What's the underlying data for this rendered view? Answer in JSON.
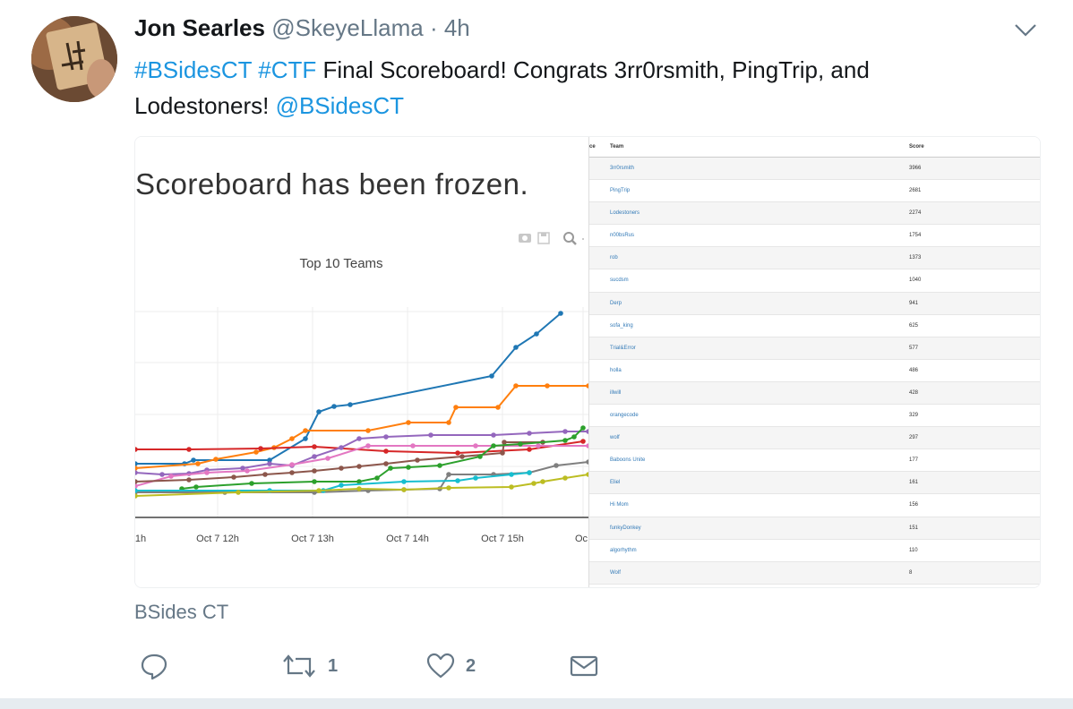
{
  "tweet": {
    "author_name": "Jon Searles",
    "handle": "@SkeyeLlama",
    "separator": "·",
    "time": "4h",
    "text_parts": {
      "hashtag1": "#BSidesCT",
      "hashtag2": "#CTF",
      "body": " Final Scoreboard! Congrats 3rr0rsmith, PingTrip, and Lodestoners! ",
      "mention": "@BSidesCT"
    },
    "card_source": "BSides CT",
    "reply_count": "",
    "retweet_count": "1",
    "like_count": "2"
  },
  "media": {
    "banner": "Scoreboard has been frozen.",
    "chart_data": {
      "type": "line",
      "title": "Top 10 Teams",
      "x_ticks": [
        "1h",
        "Oct 7 12h",
        "Oct 7 13h",
        "Oct 7 14h",
        "Oct 7 15h",
        "Oc"
      ],
      "series": [
        {
          "color": "#1f77b4",
          "points": [
            [
              0,
              60
            ],
            [
              55,
              60
            ],
            [
              65,
              64
            ],
            [
              150,
              64
            ],
            [
              190,
              88
            ],
            [
              205,
              118
            ],
            [
              222,
              124
            ],
            [
              240,
              126
            ],
            [
              398,
              158
            ],
            [
              425,
              190
            ],
            [
              448,
              205
            ],
            [
              475,
              228
            ]
          ]
        },
        {
          "color": "#ff7f0e",
          "points": [
            [
              0,
              55
            ],
            [
              70,
              60
            ],
            [
              90,
              65
            ],
            [
              135,
              73
            ],
            [
              155,
              78
            ],
            [
              175,
              88
            ],
            [
              190,
              97
            ],
            [
              260,
              97
            ],
            [
              305,
              106
            ],
            [
              350,
              106
            ],
            [
              358,
              123
            ],
            [
              405,
              123
            ],
            [
              425,
              147
            ],
            [
              460,
              147
            ],
            [
              506,
              147
            ]
          ]
        },
        {
          "color": "#d62728",
          "points": [
            [
              0,
              76
            ],
            [
              60,
              76
            ],
            [
              140,
              77
            ],
            [
              200,
              79
            ],
            [
              280,
              74
            ],
            [
              360,
              72
            ],
            [
              440,
              76
            ],
            [
              500,
              85
            ]
          ]
        },
        {
          "color": "#9467bd",
          "points": [
            [
              0,
              50
            ],
            [
              30,
              48
            ],
            [
              60,
              49
            ],
            [
              80,
              53
            ],
            [
              120,
              55
            ],
            [
              150,
              60
            ],
            [
              175,
              58
            ],
            [
              200,
              68
            ],
            [
              230,
              78
            ],
            [
              250,
              88
            ],
            [
              280,
              90
            ],
            [
              330,
              92
            ],
            [
              400,
              92
            ],
            [
              440,
              94
            ],
            [
              480,
              96
            ],
            [
              506,
              96
            ]
          ]
        },
        {
          "color": "#e377c2",
          "points": [
            [
              0,
              35
            ],
            [
              40,
              46
            ],
            [
              80,
              50
            ],
            [
              125,
              52
            ],
            [
              175,
              59
            ],
            [
              215,
              66
            ],
            [
              260,
              80
            ],
            [
              310,
              80
            ],
            [
              380,
              80
            ],
            [
              450,
              80
            ],
            [
              506,
              80
            ]
          ]
        },
        {
          "color": "#8c564b",
          "points": [
            [
              0,
              40
            ],
            [
              60,
              42
            ],
            [
              110,
              45
            ],
            [
              145,
              48
            ],
            [
              175,
              50
            ],
            [
              200,
              52
            ],
            [
              230,
              55
            ],
            [
              250,
              57
            ],
            [
              280,
              60
            ],
            [
              315,
              64
            ],
            [
              365,
              68
            ],
            [
              410,
              72
            ],
            [
              412,
              84
            ],
            [
              455,
              84
            ]
          ]
        },
        {
          "color": "#2ca02c",
          "points": [
            [
              52,
              32
            ],
            [
              68,
              34
            ],
            [
              130,
              38
            ],
            [
              200,
              40
            ],
            [
              250,
              40
            ],
            [
              270,
              44
            ],
            [
              285,
              55
            ],
            [
              305,
              56
            ],
            [
              340,
              58
            ],
            [
              385,
              68
            ],
            [
              400,
              80
            ],
            [
              430,
              82
            ],
            [
              480,
              86
            ],
            [
              490,
              90
            ],
            [
              500,
              100
            ]
          ]
        },
        {
          "color": "#7f7f7f",
          "points": [
            [
              0,
              28
            ],
            [
              100,
              28
            ],
            [
              200,
              28
            ],
            [
              260,
              30
            ],
            [
              300,
              31
            ],
            [
              340,
              32
            ],
            [
              350,
              48
            ],
            [
              400,
              48
            ],
            [
              440,
              50
            ],
            [
              470,
              58
            ],
            [
              506,
              62
            ]
          ]
        },
        {
          "color": "#17becf",
          "points": [
            [
              0,
              30
            ],
            [
              150,
              30
            ],
            [
              210,
              30
            ],
            [
              230,
              36
            ],
            [
              300,
              40
            ],
            [
              360,
              41
            ],
            [
              380,
              44
            ],
            [
              420,
              48
            ],
            [
              440,
              50
            ]
          ]
        },
        {
          "color": "#bcbd22",
          "points": [
            [
              0,
              24
            ],
            [
              115,
              28
            ],
            [
              205,
              30
            ],
            [
              250,
              32
            ],
            [
              300,
              31
            ],
            [
              350,
              33
            ],
            [
              420,
              34
            ],
            [
              445,
              38
            ],
            [
              455,
              40
            ],
            [
              480,
              44
            ],
            [
              506,
              48
            ]
          ]
        }
      ]
    },
    "table": {
      "headers": {
        "rank": "ce",
        "team": "Team",
        "score": "Score"
      },
      "rows": [
        {
          "team": "3rr0rsmith",
          "score": "3966"
        },
        {
          "team": "PingTrip",
          "score": "2681"
        },
        {
          "team": "Lodestoners",
          "score": "2274"
        },
        {
          "team": "n00bsRus",
          "score": "1754"
        },
        {
          "team": "rob",
          "score": "1373"
        },
        {
          "team": "sucdsm",
          "score": "1040"
        },
        {
          "team": "Derp",
          "score": "941"
        },
        {
          "team": "sofa_king",
          "score": "625"
        },
        {
          "team": "Trial&Error",
          "score": "577"
        },
        {
          "team": "holla",
          "score": "486"
        },
        {
          "team": "illwill",
          "score": "428"
        },
        {
          "team": "orangecode",
          "score": "329"
        },
        {
          "team": "wolf",
          "score": "297"
        },
        {
          "team": "Baboons Unite",
          "score": "177"
        },
        {
          "team": "Eliel",
          "score": "161"
        },
        {
          "team": "Hi Mom",
          "score": "156"
        },
        {
          "team": "funkyDonkey",
          "score": "151"
        },
        {
          "team": "algorhythm",
          "score": "110"
        },
        {
          "team": "Wolf",
          "score": "8"
        }
      ]
    }
  }
}
